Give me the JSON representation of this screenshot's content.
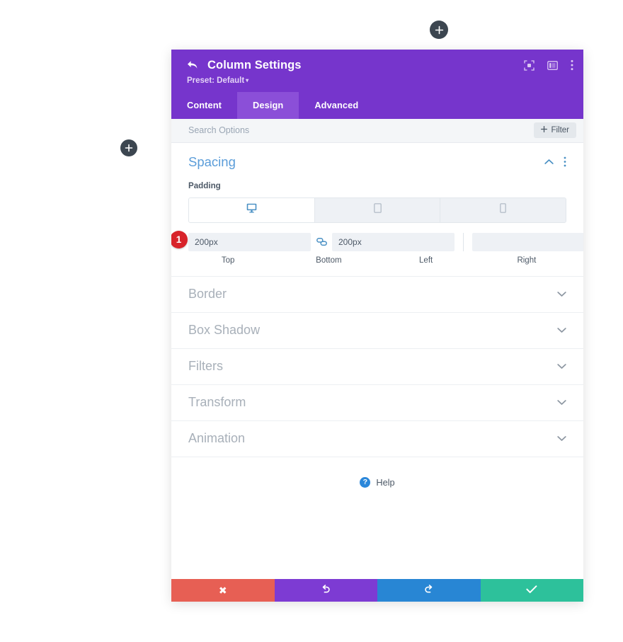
{
  "canvas": {
    "add_button_top": {
      "icon": "plus-icon",
      "label": "+"
    },
    "add_button_left": {
      "icon": "plus-icon",
      "label": "+"
    }
  },
  "panel": {
    "header": {
      "back_icon": "back-arrow-icon",
      "title": "Column Settings",
      "preset_label": "Preset: Default",
      "preset_caret": "▾",
      "icons": [
        {
          "name": "focus-icon",
          "label": "Focus"
        },
        {
          "name": "layout-columns-icon",
          "label": "Layout"
        },
        {
          "name": "more-vertical-icon",
          "label": "More"
        }
      ],
      "accent_color": "#7635cc"
    },
    "tabs": [
      {
        "label": "Content",
        "active": false
      },
      {
        "label": "Design",
        "active": true
      },
      {
        "label": "Advanced",
        "active": false
      }
    ],
    "tab_active_color": "#8b4fd8",
    "search": {
      "placeholder": "Search Options",
      "value": "",
      "filter_button": {
        "label": "Filter",
        "icon": "plus-icon"
      }
    },
    "spacing_section": {
      "title": "Spacing",
      "title_color": "#5b9dd9",
      "collapse_icon": "chevron-up-icon",
      "menu_icon": "more-vertical-icon",
      "padding_label": "Padding",
      "device_tabs": [
        {
          "name": "desktop-icon",
          "label": "Desktop",
          "active": true
        },
        {
          "name": "tablet-icon",
          "label": "Tablet",
          "active": false
        },
        {
          "name": "phone-icon",
          "label": "Phone",
          "active": false
        }
      ],
      "annotation_badge": "1",
      "annotation_color": "#d8232a",
      "fields": [
        {
          "label": "Top",
          "value": "200px",
          "placeholder": ""
        },
        {
          "label": "Bottom",
          "value": "200px",
          "placeholder": ""
        },
        {
          "label": "Left",
          "value": "",
          "placeholder": ""
        },
        {
          "label": "Right",
          "value": "",
          "placeholder": ""
        }
      ],
      "link_left": {
        "name": "link-connected-icon",
        "state": "linked"
      },
      "link_right": {
        "name": "link-broken-icon",
        "state": "unlinked"
      }
    },
    "sections": [
      {
        "label": "Border",
        "icon": "chevron-down-icon"
      },
      {
        "label": "Box Shadow",
        "icon": "chevron-down-icon"
      },
      {
        "label": "Filters",
        "icon": "chevron-down-icon"
      },
      {
        "label": "Transform",
        "icon": "chevron-down-icon"
      },
      {
        "label": "Animation",
        "icon": "chevron-down-icon"
      }
    ],
    "help": {
      "badge": "?",
      "label": "Help"
    },
    "footer_buttons": [
      {
        "name": "cancel-button",
        "icon": "close-x-icon",
        "glyph": "✖",
        "color": "#e75f54"
      },
      {
        "name": "undo-button",
        "icon": "undo-icon",
        "glyph": "↺",
        "color": "#7d3bd3"
      },
      {
        "name": "redo-button",
        "icon": "redo-icon",
        "glyph": "↻",
        "color": "#2886d4"
      },
      {
        "name": "save-button",
        "icon": "checkmark-icon",
        "glyph": "✔",
        "color": "#2dc19b"
      }
    ]
  }
}
